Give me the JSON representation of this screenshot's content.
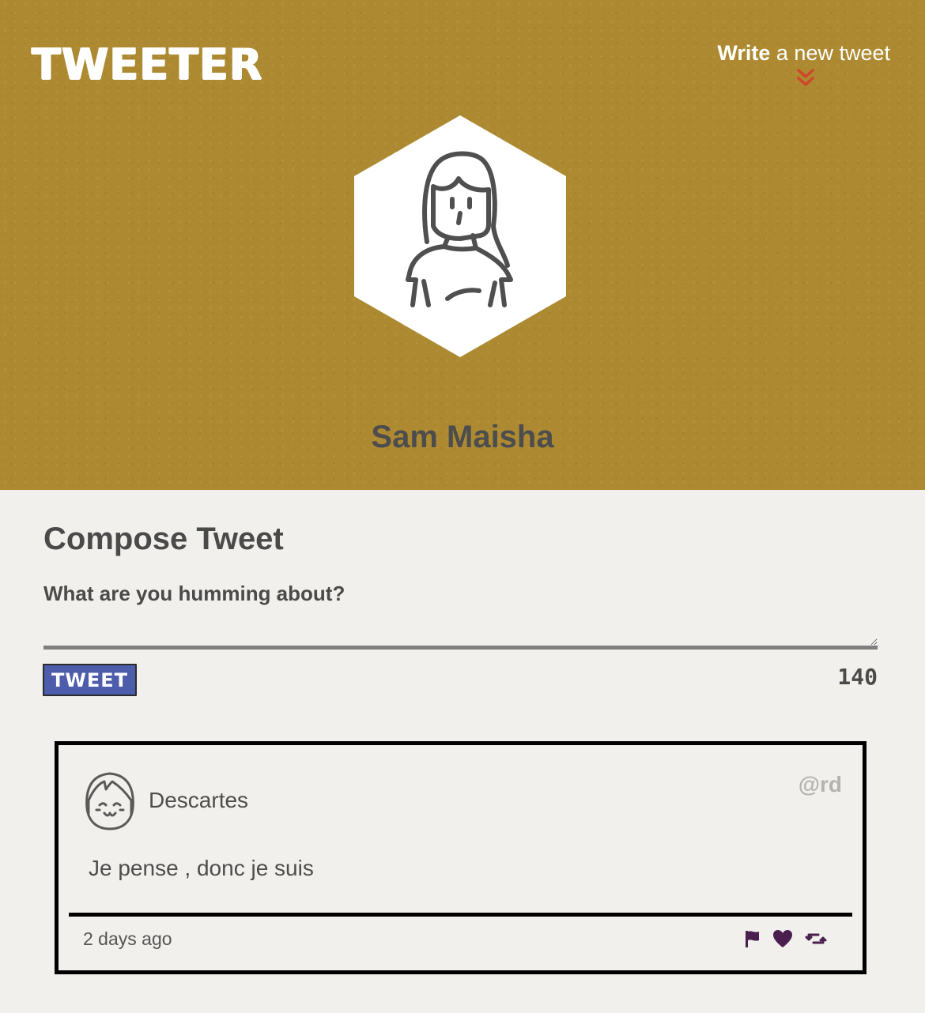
{
  "header": {
    "brand": "TWEETER",
    "write_link_strong": "Write",
    "write_link_rest": " a new tweet",
    "chevron_icon": "double-chevron-down-icon",
    "chevron_color": "#d0442a",
    "background_color": "#ad8a31"
  },
  "profile": {
    "avatar_icon": "user-avatar-icon",
    "name": "Sam Maisha"
  },
  "compose": {
    "title": "Compose Tweet",
    "placeholder": "What are you humming about?",
    "tweet_button_label": "TWEET",
    "char_counter": "140",
    "button_color": "#4e5dab"
  },
  "tweets": [
    {
      "avatar_icon": "user-avatar-icon",
      "name": "Descartes",
      "handle": "@rd",
      "text": "Je pense , donc je suis",
      "time": "2 days ago",
      "actions": [
        "flag-icon",
        "heart-icon",
        "retweet-icon"
      ],
      "action_color": "#4a1e4e"
    }
  ]
}
